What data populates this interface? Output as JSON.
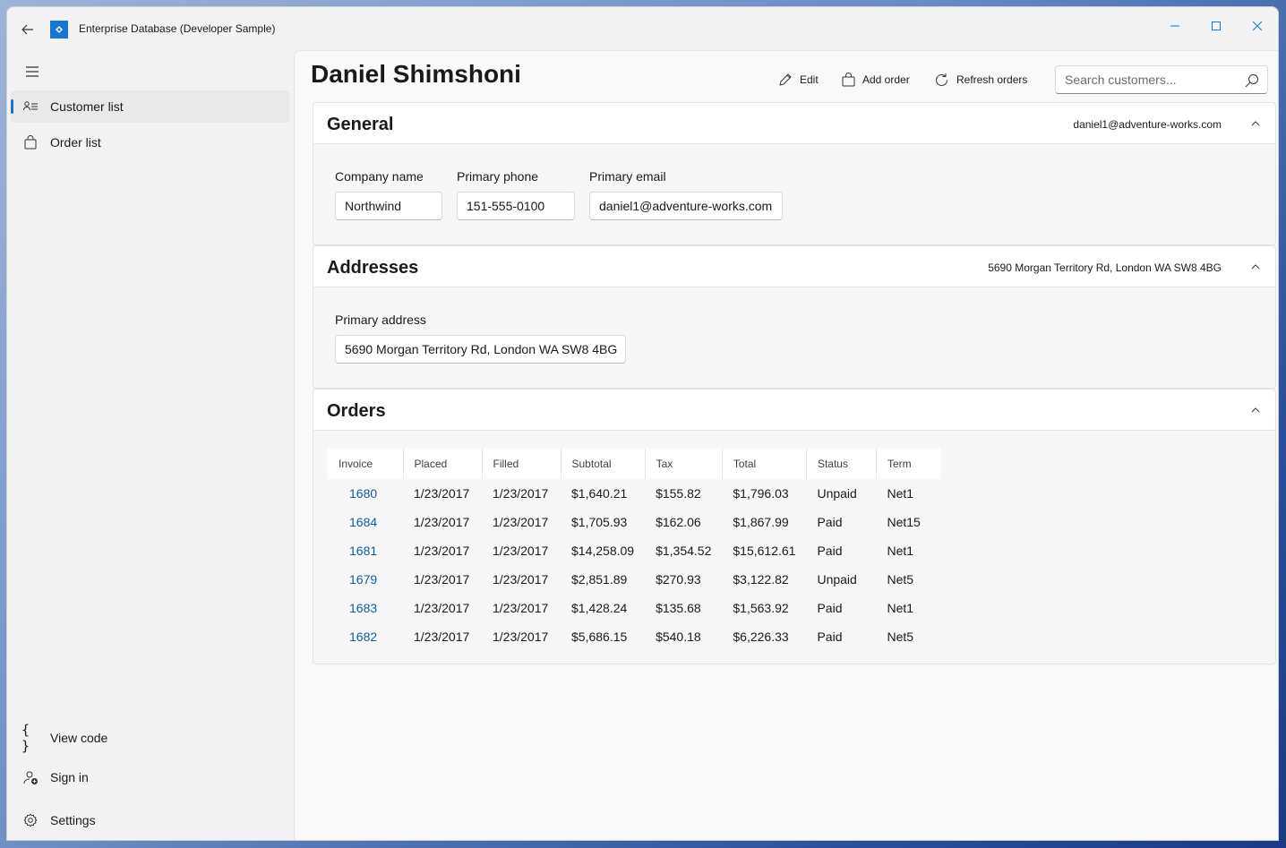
{
  "window": {
    "title": "Enterprise Database (Developer Sample)",
    "accent_color": "#1677d2"
  },
  "nav": {
    "items": [
      {
        "label": "Customer list",
        "icon": "people-list-icon",
        "selected": true
      },
      {
        "label": "Order list",
        "icon": "shopping-bag-icon",
        "selected": false
      }
    ],
    "footer": [
      {
        "label": "View code",
        "icon": "braces-icon"
      },
      {
        "label": "Sign in",
        "icon": "person-add-icon"
      },
      {
        "label": "Settings",
        "icon": "gear-icon"
      }
    ]
  },
  "header": {
    "customer_name": "Daniel Shimshoni",
    "commands": {
      "edit": "Edit",
      "add_order": "Add order",
      "refresh_orders": "Refresh orders"
    },
    "search_placeholder": "Search customers..."
  },
  "general": {
    "title": "General",
    "summary": "daniel1@adventure-works.com",
    "fields": {
      "company_label": "Company name",
      "company_value": "Northwind",
      "phone_label": "Primary phone",
      "phone_value": "151-555-0100",
      "email_label": "Primary email",
      "email_value": "daniel1@adventure-works.com"
    }
  },
  "addresses": {
    "title": "Addresses",
    "summary": "5690 Morgan Territory Rd, London WA SW8 4BG",
    "primary_label": "Primary address",
    "primary_value": "5690 Morgan Territory Rd, London WA SW8 4BG"
  },
  "orders": {
    "title": "Orders",
    "columns": [
      "Invoice",
      "Placed",
      "Filled",
      "Subtotal",
      "Tax",
      "Total",
      "Status",
      "Term"
    ],
    "rows": [
      [
        "1680",
        "1/23/2017",
        "1/23/2017",
        "$1,640.21",
        "$155.82",
        "$1,796.03",
        "Unpaid",
        "Net1"
      ],
      [
        "1684",
        "1/23/2017",
        "1/23/2017",
        "$1,705.93",
        "$162.06",
        "$1,867.99",
        "Paid",
        "Net15"
      ],
      [
        "1681",
        "1/23/2017",
        "1/23/2017",
        "$14,258.09",
        "$1,354.52",
        "$15,612.61",
        "Paid",
        "Net1"
      ],
      [
        "1679",
        "1/23/2017",
        "1/23/2017",
        "$2,851.89",
        "$270.93",
        "$3,122.82",
        "Unpaid",
        "Net5"
      ],
      [
        "1683",
        "1/23/2017",
        "1/23/2017",
        "$1,428.24",
        "$135.68",
        "$1,563.92",
        "Paid",
        "Net1"
      ],
      [
        "1682",
        "1/23/2017",
        "1/23/2017",
        "$5,686.15",
        "$540.18",
        "$6,226.33",
        "Paid",
        "Net5"
      ]
    ]
  }
}
